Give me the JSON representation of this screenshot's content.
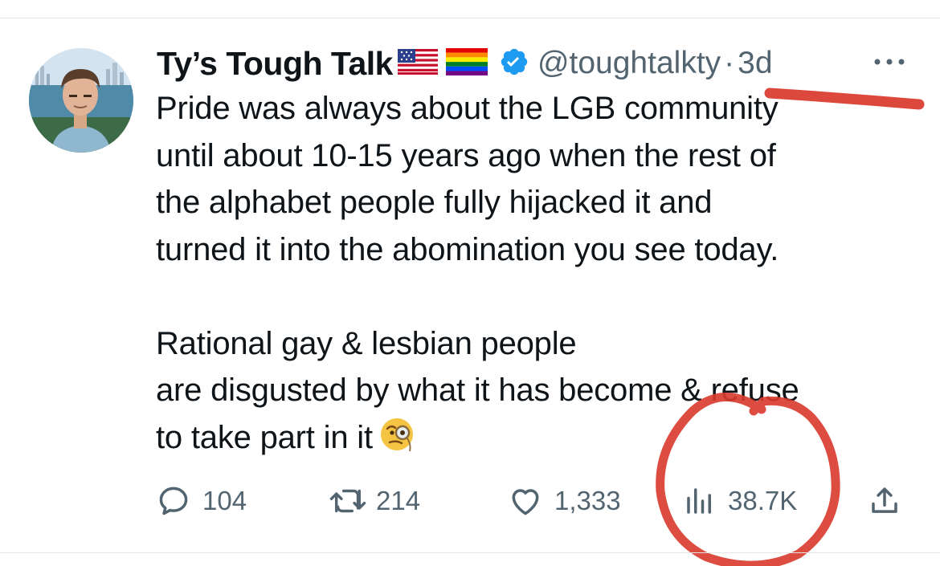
{
  "tweet": {
    "display_name": "Ty’s Tough Talk",
    "handle": "@toughtalkty",
    "separator": "·",
    "time": "3d",
    "paragraph1_lines": [
      "Pride was always about the LGB community",
      "until about 10-15 years ago when the rest of",
      "the alphabet people fully hijacked it and",
      "turned it into the abomination you see today."
    ],
    "paragraph2_lines": [
      "Rational gay & lesbian people",
      "are disgusted by what it has become & refuse",
      "to take part in it"
    ],
    "emoji": "face-with-monocle",
    "badges": [
      "us-flag",
      "rainbow-flag",
      "verified-badge"
    ]
  },
  "actions": {
    "replies": "104",
    "retweets": "214",
    "likes": "1,333",
    "views": "38.7K"
  },
  "annotations": {
    "color": "#d9382b",
    "marks": [
      "underline-under-time",
      "circle-around-views"
    ]
  },
  "colors": {
    "text": "#0f1419",
    "secondary": "#536471",
    "verified": "#1d9bf0"
  }
}
